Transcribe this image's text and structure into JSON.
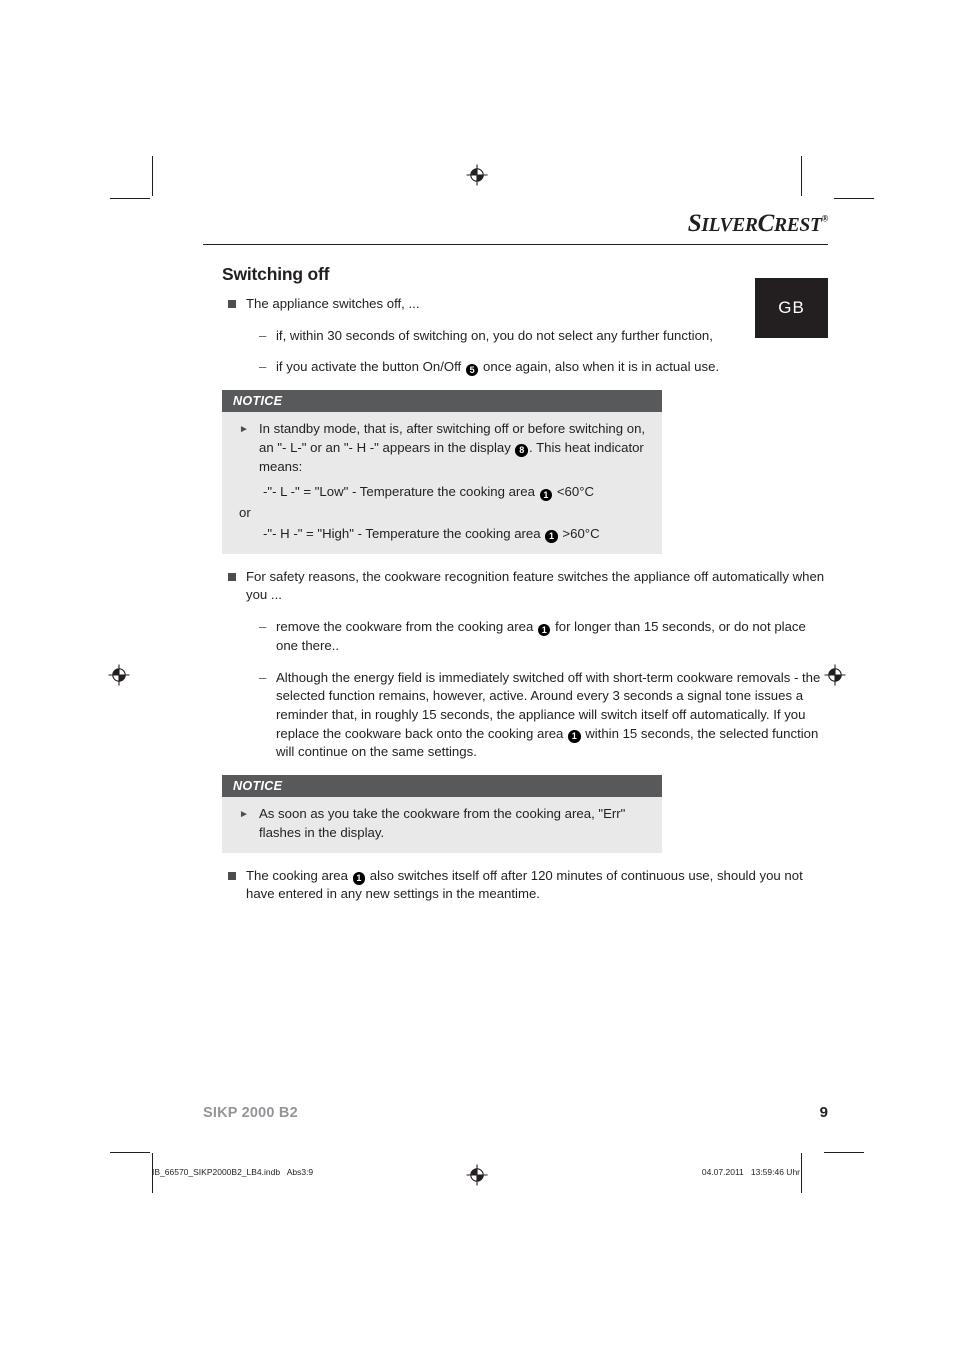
{
  "brand": {
    "name_part1": "S",
    "name_part2": "ILVER",
    "name_part3": "C",
    "name_part4": "REST",
    "registered_mark": "®"
  },
  "language_tab": {
    "label": "GB"
  },
  "page_title": "Switching off",
  "body": [
    {
      "kind": "bullet-square",
      "text": "The appliance switches off, ..."
    },
    {
      "kind": "bullet-dash",
      "text": "if, within 30 seconds of switching on, you do not select any further function,"
    },
    {
      "kind": "bullet-dash",
      "text_before": "if you activate the button On/Off ",
      "badge": "5",
      "text_after": " once again, also when it is in actual use."
    }
  ],
  "notice1": {
    "header": "NOTICE",
    "lead_before": "In standby mode, that is, after switching off or before switching on, an \"- L-\" or an \"- H -\" appears in the display ",
    "lead_badge": "8",
    "lead_after": ". This heat indicator means:",
    "option_low_before": "-\"- L -\" = \"Low\" - Temperature the cooking area ",
    "option_low_badge": "1",
    "option_low_after": " <60°C",
    "separator": "or",
    "option_high_before": "-\"- H -\" = \"High\" - Temperature the cooking area ",
    "option_high_badge": "1",
    "option_high_after": " >60°C"
  },
  "body2": [
    {
      "kind": "bullet-square",
      "text": "For safety reasons, the cookware recognition feature switches the appliance off automatically when you ..."
    },
    {
      "kind": "bullet-dash",
      "text_before": "remove the cookware from the cooking area ",
      "badge": "1",
      "text_after": " for longer than 15 seconds, or do not place one there.."
    },
    {
      "kind": "bullet-dash",
      "text_before": "Although the energy field is immediately switched off with short-term cookware removals - the selected function remains, however, active. Around every 3 seconds a signal tone issues a reminder that, in roughly 15 seconds, the appliance will switch itself off automatically. If you replace the cookware back onto the cooking area ",
      "badge": "1",
      "text_after": " within 15 seconds, the selected function will continue on the same settings."
    }
  ],
  "notice2": {
    "header": "NOTICE",
    "text": "As soon as you take the cookware from the cooking area, \"Err\" flashes in the display."
  },
  "body3": [
    {
      "kind": "bullet-square",
      "text_before": "The cooking area ",
      "badge": "1",
      "text_after": " also switches itself off after 120 minutes of continuous use, should you not have entered in any new settings in the meantime."
    }
  ],
  "footer": {
    "document_id": "SIKP 2000 B2",
    "page_number": "9"
  },
  "print_marks": {
    "file_name": "IB_66570_SIKP2000B2_LB4.indb   Abs3:9",
    "timestamp": "04.07.2011   13:59:46 Uhr"
  },
  "colors": {
    "notice_header_bg": "#58595b",
    "notice_body_bg": "#e9e9ea",
    "lang_tab_bg": "#231f20",
    "doc_id_gray": "#939598",
    "text": "#231f20"
  }
}
